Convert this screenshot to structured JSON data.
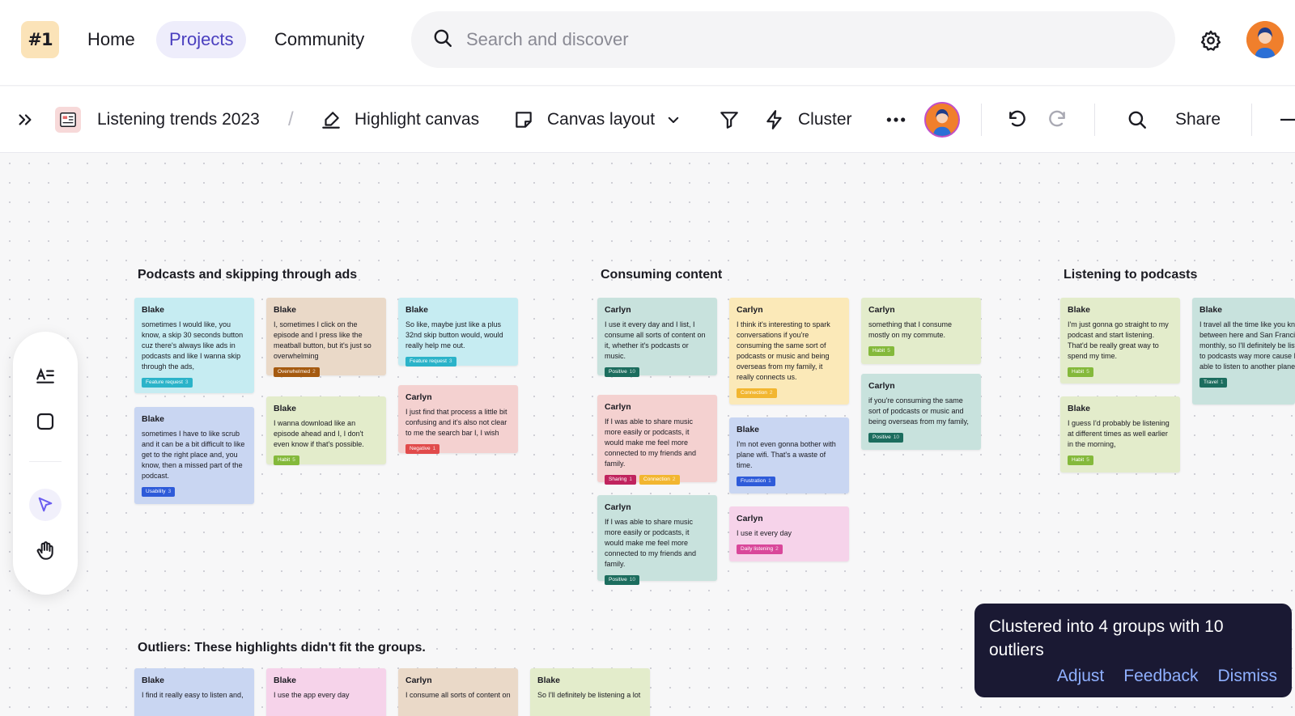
{
  "app": {
    "logo_text": "#1"
  },
  "nav": {
    "home": "Home",
    "projects": "Projects",
    "community": "Community"
  },
  "search": {
    "placeholder": "Search and discover"
  },
  "toolbar": {
    "project_title": "Listening trends 2023",
    "breadcrumb_sep": "/",
    "highlight_canvas": "Highlight canvas",
    "canvas_layout": "Canvas layout",
    "cluster": "Cluster",
    "share": "Share"
  },
  "groups": [
    {
      "title": "Podcasts and skipping through ads",
      "cards": [
        {
          "author": "Blake",
          "text": "sometimes I would like, you know, a skip 30 seconds button cuz there's always like ads in podcasts and like I wanna skip through the ads,",
          "tags": [
            {
              "label": "Feature request",
              "count": "3",
              "color": "#2bb3c9"
            }
          ]
        },
        {
          "author": "Blake",
          "text": "sometimes I have to like scrub and it can be a bit difficult to like get to the right place and, you know, then a missed part of the podcast.",
          "tags": [
            {
              "label": "Usability",
              "count": "3",
              "color": "#2e5bd9"
            }
          ]
        },
        {
          "author": "Blake",
          "text": "I, sometimes I click on the episode and I press like the meatball button, but it's just so overwhelming",
          "tags": [
            {
              "label": "Overwhelmed",
              "count": "2",
              "color": "#a55a10"
            }
          ]
        },
        {
          "author": "Blake",
          "text": "I wanna download like an episode ahead and I, I don't even know if that's possible.",
          "tags": [
            {
              "label": "Habit",
              "count": "5",
              "color": "#84b93b"
            }
          ]
        },
        {
          "author": "Blake",
          "text": "So like, maybe just like a plus 32nd skip button would, would really help me out.",
          "tags": [
            {
              "label": "Feature request",
              "count": "3",
              "color": "#2bb3c9"
            }
          ]
        },
        {
          "author": "Carlyn",
          "text": "I just find that process a little bit confusing and it's also not clear to me the search bar I, I wish",
          "tags": [
            {
              "label": "Negative",
              "count": "1",
              "color": "#e14b4b"
            }
          ]
        }
      ]
    },
    {
      "title": "Consuming content",
      "cards": [
        {
          "author": "Carlyn",
          "text": "I use it every day and I list, I consume all sorts of content on it, whether it's podcasts or music.",
          "tags": [
            {
              "label": "Positive",
              "count": "10",
              "color": "#1c6d5e"
            }
          ]
        },
        {
          "author": "Carlyn",
          "text": "If I was able to share music more easily or podcasts, it would make me feel more connected to my friends and family.",
          "tags": [
            {
              "label": "Sharing",
              "count": "1",
              "color": "#c0245e"
            },
            {
              "label": "Connection",
              "count": "2",
              "color": "#f2b630"
            }
          ]
        },
        {
          "author": "Carlyn",
          "text": "If I was able to share music more easily or podcasts, it would make me feel more connected to my friends and family.",
          "tags": [
            {
              "label": "Positive",
              "count": "10",
              "color": "#1c6d5e"
            }
          ]
        },
        {
          "author": "Carlyn",
          "text": "I think it's interesting to spark conversations if you're consuming the same sort of podcasts or music and being overseas from my family, it really connects us.",
          "tags": [
            {
              "label": "Connection",
              "count": "2",
              "color": "#f2b630"
            }
          ]
        },
        {
          "author": "Blake",
          "text": "I'm not even gonna bother with plane wifi. That's a waste of time.",
          "tags": [
            {
              "label": "Frustration",
              "count": "1",
              "color": "#2e5bd9"
            }
          ]
        },
        {
          "author": "Carlyn",
          "text": "I use it every day",
          "tags": [
            {
              "label": "Daily listening",
              "count": "2",
              "color": "#d9479a"
            }
          ]
        },
        {
          "author": "Carlyn",
          "text": "something that I consume mostly on my commute.",
          "tags": [
            {
              "label": "Habit",
              "count": "5",
              "color": "#84b93b"
            }
          ]
        },
        {
          "author": "Carlyn",
          "text": "if you're consuming the same sort of podcasts or music and being overseas from my family,",
          "tags": [
            {
              "label": "Positive",
              "count": "10",
              "color": "#1c6d5e"
            }
          ]
        }
      ]
    },
    {
      "title": "Listening to podcasts",
      "cards": [
        {
          "author": "Blake",
          "text": "I'm just gonna go straight to my podcast and start listening. That'd be really great way to spend my time.",
          "tags": [
            {
              "label": "Habit",
              "count": "5",
              "color": "#84b93b"
            }
          ]
        },
        {
          "author": "Blake",
          "text": "I guess I'd probably be listening at different times as well earlier in the morning,",
          "tags": [
            {
              "label": "Habit",
              "count": "5",
              "color": "#84b93b"
            }
          ]
        },
        {
          "author": "Blake",
          "text": "I travel all the time like you know between here and San Francisco monthly, so I'll definitely be listening to podcasts way more cause I'll be able to listen to another plane.",
          "tags": [
            {
              "label": "Travel",
              "count": "1",
              "color": "#1c6d5e"
            }
          ]
        }
      ]
    }
  ],
  "outliers": {
    "title": "Outliers: These highlights didn't fit the groups.",
    "cards": [
      {
        "author": "Blake",
        "text": "I find it really easy to listen and,"
      },
      {
        "author": "Blake",
        "text": "I use the app every day"
      },
      {
        "author": "Carlyn",
        "text": "I consume all sorts of content on"
      },
      {
        "author": "Blake",
        "text": "So I'll definitely be listening a lot"
      }
    ]
  },
  "toast": {
    "message": "Clustered into 4 groups with 10 outliers",
    "adjust": "Adjust",
    "feedback": "Feedback",
    "dismiss": "Dismiss"
  },
  "colors": {
    "accent": "#4a3fbf",
    "toast_bg": "#1a1933",
    "toast_link": "#8fb0ff"
  }
}
